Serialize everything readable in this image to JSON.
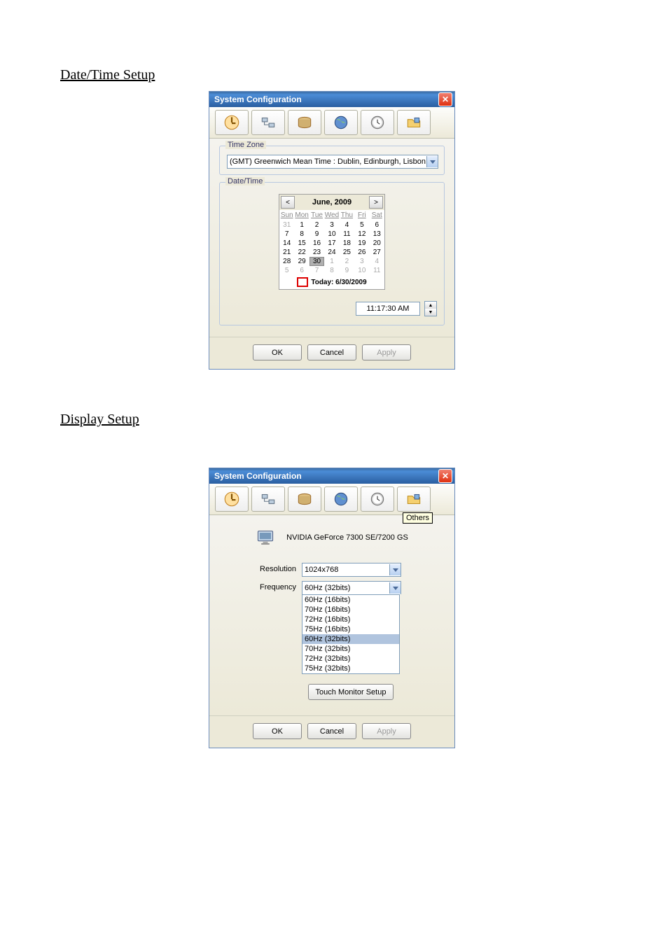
{
  "section1_title": "Date/Time Setup",
  "section2_title": "Display Setup",
  "win_title": "System Configuration",
  "toolbar_icons": [
    "config-icon",
    "network-icon",
    "disk-icon",
    "globe-icon",
    "clock-icon",
    "folder-icon"
  ],
  "tooltip_others": "Others",
  "timezone_legend": "Time Zone",
  "timezone_value": "(GMT) Greenwich Mean Time : Dublin, Edinburgh, Lisbon, London",
  "datetime_legend": "Date/Time",
  "cal_month": "June, 2009",
  "cal_dayheaders": [
    "Sun",
    "Mon",
    "Tue",
    "Wed",
    "Thu",
    "Fri",
    "Sat"
  ],
  "cal_rows": [
    [
      {
        "d": "31",
        "t": "other"
      },
      {
        "d": "1"
      },
      {
        "d": "2"
      },
      {
        "d": "3"
      },
      {
        "d": "4"
      },
      {
        "d": "5"
      },
      {
        "d": "6"
      }
    ],
    [
      {
        "d": "7"
      },
      {
        "d": "8"
      },
      {
        "d": "9"
      },
      {
        "d": "10"
      },
      {
        "d": "11"
      },
      {
        "d": "12"
      },
      {
        "d": "13"
      }
    ],
    [
      {
        "d": "14"
      },
      {
        "d": "15"
      },
      {
        "d": "16"
      },
      {
        "d": "17"
      },
      {
        "d": "18"
      },
      {
        "d": "19"
      },
      {
        "d": "20"
      }
    ],
    [
      {
        "d": "21"
      },
      {
        "d": "22"
      },
      {
        "d": "23"
      },
      {
        "d": "24"
      },
      {
        "d": "25"
      },
      {
        "d": "26"
      },
      {
        "d": "27"
      }
    ],
    [
      {
        "d": "28"
      },
      {
        "d": "29"
      },
      {
        "d": "30",
        "t": "sel"
      },
      {
        "d": "1",
        "t": "other"
      },
      {
        "d": "2",
        "t": "other"
      },
      {
        "d": "3",
        "t": "other"
      },
      {
        "d": "4",
        "t": "other"
      }
    ],
    [
      {
        "d": "5",
        "t": "other"
      },
      {
        "d": "6",
        "t": "other"
      },
      {
        "d": "7",
        "t": "other"
      },
      {
        "d": "8",
        "t": "other"
      },
      {
        "d": "9",
        "t": "other"
      },
      {
        "d": "10",
        "t": "other"
      },
      {
        "d": "11",
        "t": "other"
      }
    ]
  ],
  "cal_today_label": "Today: 6/30/2009",
  "time_value": "11:17:30 AM",
  "btn_ok": "OK",
  "btn_cancel": "Cancel",
  "btn_apply": "Apply",
  "gpu_name": "NVIDIA GeForce 7300 SE/7200 GS",
  "resolution_label": "Resolution",
  "resolution_value": "1024x768",
  "frequency_label": "Frequency",
  "frequency_value": "60Hz (32bits)",
  "frequency_options": [
    "60Hz (16bits)",
    "70Hz (16bits)",
    "72Hz (16bits)",
    "75Hz (16bits)",
    "60Hz (32bits)",
    "70Hz (32bits)",
    "72Hz (32bits)",
    "75Hz (32bits)"
  ],
  "frequency_selected_index": 4,
  "touch_btn": "Touch Monitor Setup"
}
